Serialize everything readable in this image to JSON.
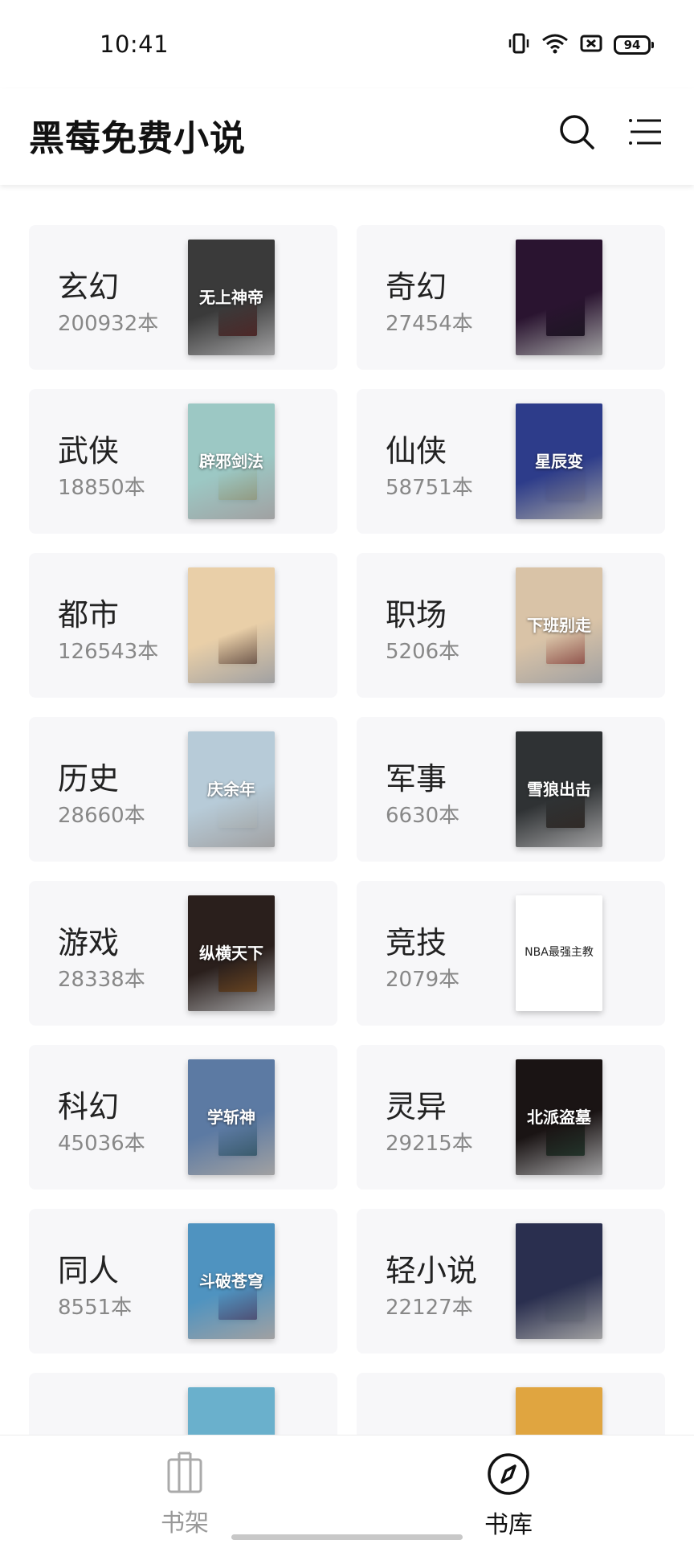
{
  "status_bar": {
    "time": "10:41",
    "battery": "94"
  },
  "header": {
    "title": "黑莓免费小说"
  },
  "categories": [
    {
      "name": "玄幻",
      "count": "200932本",
      "cover_front": "无上神帝",
      "color_front": "#3a3a3a",
      "color_back": "#8a2b2b"
    },
    {
      "name": "奇幻",
      "count": "27454本",
      "cover_front": "",
      "color_front": "#2a1430",
      "color_back": "#22242a"
    },
    {
      "name": "武侠",
      "count": "18850本",
      "cover_front": "辟邪剑法",
      "color_front": "#9cc8c4",
      "color_back": "#d7c088"
    },
    {
      "name": "仙侠",
      "count": "58751本",
      "cover_front": "星辰变",
      "color_front": "#2d3c8a",
      "color_back": "#e9e2db"
    },
    {
      "name": "都市",
      "count": "126543本",
      "cover_front": "",
      "color_front": "#e9cfa8",
      "color_back": "#3d1e24"
    },
    {
      "name": "职场",
      "count": "5206本",
      "cover_front": "下班别走",
      "color_front": "#d9c3a7",
      "color_back": "#9b1d24"
    },
    {
      "name": "历史",
      "count": "28660本",
      "cover_front": "庆余年",
      "color_front": "#b7cbd8",
      "color_back": "#f2ede6"
    },
    {
      "name": "军事",
      "count": "6630本",
      "cover_front": "雪狼出击",
      "color_front": "#2f3234",
      "color_back": "#4a3a30"
    },
    {
      "name": "游戏",
      "count": "28338本",
      "cover_front": "纵横天下",
      "color_front": "#2a1f1c",
      "color_back": "#d88b3a"
    },
    {
      "name": "竞技",
      "count": "2079本",
      "cover_front": "NBA最强主教",
      "color_front": "#ffffff",
      "color_back": "#26325e"
    },
    {
      "name": "科幻",
      "count": "45036本",
      "cover_front": "学斩神",
      "color_front": "#5c7aa3",
      "color_back": "#3a6f73"
    },
    {
      "name": "灵异",
      "count": "29215本",
      "cover_front": "北派盗墓",
      "color_front": "#1a1414",
      "color_back": "#3f6f58"
    },
    {
      "name": "同人",
      "count": "8551本",
      "cover_front": "斗破苍穹",
      "color_front": "#4f93c0",
      "color_back": "#7a3a6a"
    },
    {
      "name": "轻小说",
      "count": "22127本",
      "cover_front": "",
      "color_front": "#2a2f4f",
      "color_back": "#dfe5e2"
    },
    {
      "name": "",
      "count": "",
      "cover_front": "",
      "color_front": "#6ab0cc",
      "color_back": "#c9302c"
    },
    {
      "name": "",
      "count": "",
      "cover_front": "",
      "color_front": "#e0a540",
      "color_back": "#d8dde4"
    }
  ],
  "bottom_nav": {
    "shelf_label": "书架",
    "library_label": "书库"
  }
}
